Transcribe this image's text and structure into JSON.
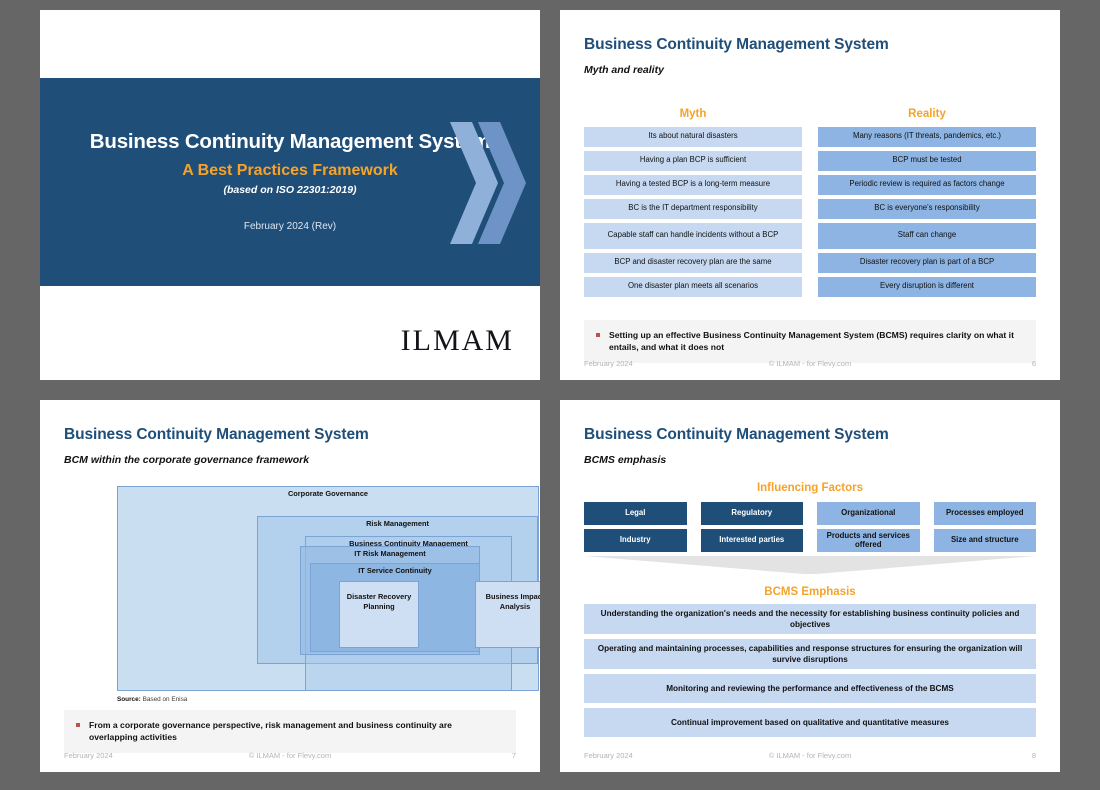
{
  "slides": {
    "title": {
      "heading": "Business Continuity Management System",
      "subheading": "A Best Practices Framework",
      "iso_note": "(based on ISO 22301:2019)",
      "date": "February 2024 (Rev)",
      "logo": "ILMAM"
    },
    "myth_reality": {
      "title": "Business Continuity Management System",
      "subtitle": "Myth and reality",
      "myth_header": "Myth",
      "reality_header": "Reality",
      "rows": [
        {
          "myth": "Its about natural disasters",
          "reality": "Many reasons (IT threats, pandemics, etc.)"
        },
        {
          "myth": "Having a plan BCP is sufficient",
          "reality": "BCP must be tested"
        },
        {
          "myth": "Having a tested BCP is a long-term measure",
          "reality": "Periodic review is required as factors change"
        },
        {
          "myth": "BC is the IT department responsibility",
          "reality": "BC is everyone's responsibility"
        },
        {
          "myth": "Capable staff can handle incidents without a BCP",
          "reality": "Staff can change"
        },
        {
          "myth": "BCP and disaster recovery plan are the same",
          "reality": "Disaster recovery plan is part of a BCP"
        },
        {
          "myth": "One disaster plan meets all scenarios",
          "reality": "Every disruption is different"
        }
      ],
      "callout": "Setting up an effective Business Continuity Management System (BCMS) requires clarity on what it entails, and what it does not",
      "footer": {
        "left": "February 2024",
        "center": "© ILMAM - for Flevy.com",
        "right": "6"
      }
    },
    "governance": {
      "title": "Business Continuity Management System",
      "subtitle": "BCM within the corporate governance framework",
      "boxes": {
        "corporate_governance": "Corporate Governance",
        "risk_management": "Risk Management",
        "business_continuity_management": "Business Continuity Management",
        "it_risk_management": "IT Risk Management",
        "it_service_continuity": "IT Service Continuity",
        "disaster_recovery_planning": "Disaster Recovery Planning",
        "business_impact_analysis": "Business Impact Analysis"
      },
      "source_label": "Source:",
      "source_value": " Based on Enisa",
      "callout": "From a corporate governance perspective, risk management and business continuity are overlapping activities",
      "footer": {
        "left": "February 2024",
        "center": "© ILMAM - for Flevy.com",
        "right": "7"
      }
    },
    "bcms_emphasis": {
      "title": "Business Continuity Management System",
      "subtitle": "BCMS emphasis",
      "influencing_header": "Influencing Factors",
      "influencing_factors": [
        {
          "label": "Legal",
          "style": "dark"
        },
        {
          "label": "Regulatory",
          "style": "dark"
        },
        {
          "label": "Organizational",
          "style": "light"
        },
        {
          "label": "Processes employed",
          "style": "light"
        },
        {
          "label": "Industry",
          "style": "dark"
        },
        {
          "label": "Interested parties",
          "style": "dark"
        },
        {
          "label": "Products and services offered",
          "style": "light"
        },
        {
          "label": "Size and structure",
          "style": "light"
        }
      ],
      "emphasis_header": "BCMS Emphasis",
      "emphasis_items": [
        "Understanding the organization's needs and the necessity for establishing business continuity policies and objectives",
        "Operating and maintaining processes, capabilities and response structures for ensuring the organization will survive disruptions",
        "Monitoring and reviewing the performance and effectiveness of the BCMS",
        "Continual improvement based on qualitative and quantitative measures"
      ],
      "footer": {
        "left": "February 2024",
        "center": "© ILMAM - for Flevy.com",
        "right": "8"
      }
    }
  },
  "colors": {
    "brand_navy": "#1f4e79",
    "accent_orange": "#f5a32a",
    "light_blue": "#c6d9f1",
    "medium_blue": "#8db4e2",
    "bullet_red": "#c0504d",
    "page_background": "#666666"
  }
}
